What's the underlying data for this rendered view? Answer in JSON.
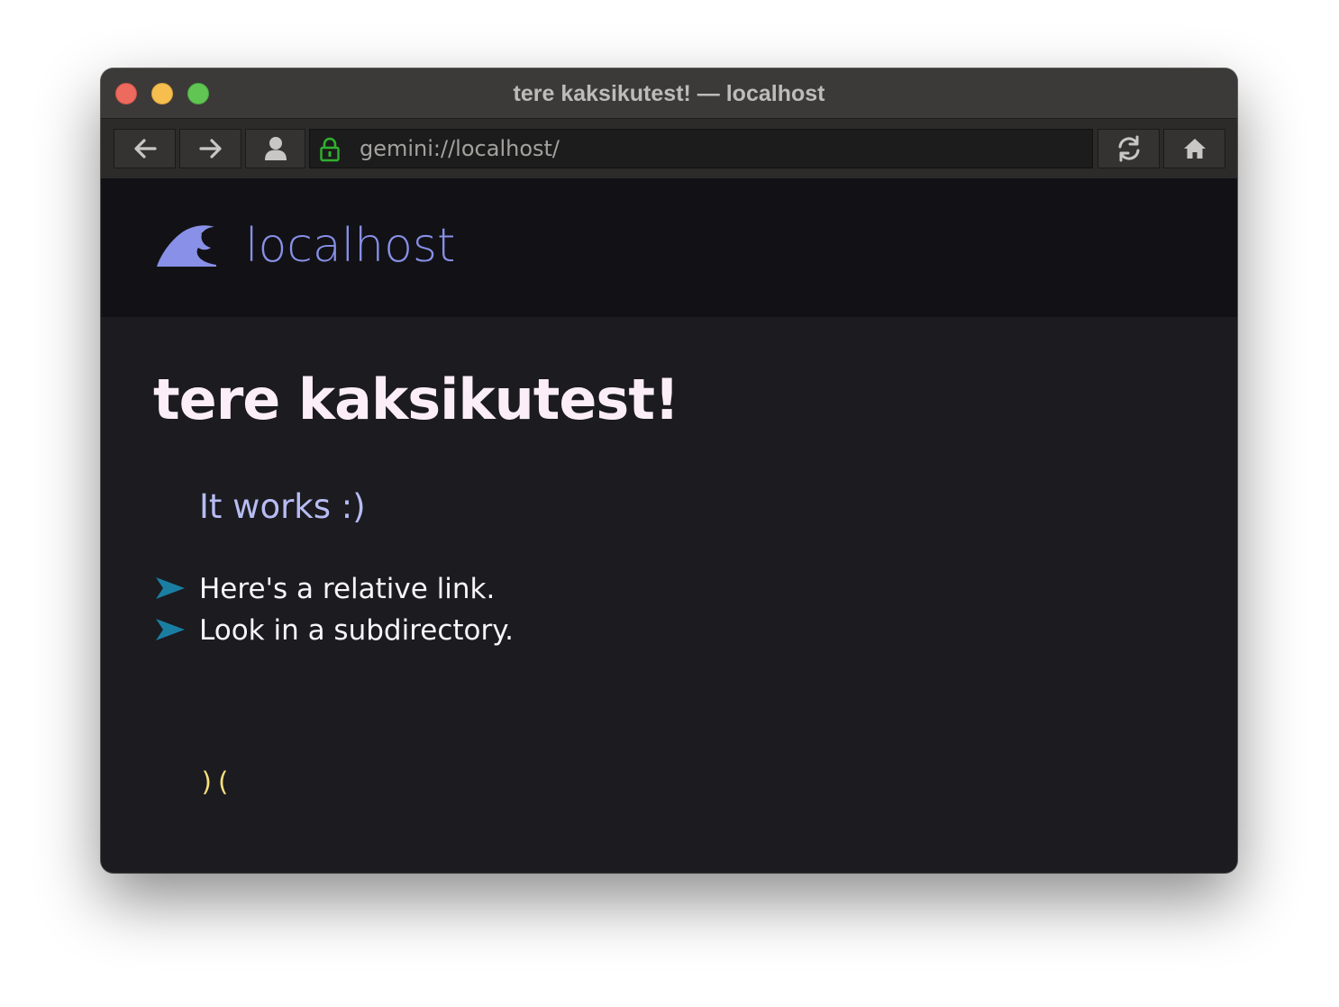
{
  "window": {
    "title": "tere kaksikutest! — localhost"
  },
  "toolbar": {
    "back_icon": "arrow-left-icon",
    "forward_icon": "arrow-right-icon",
    "identity_icon": "person-icon",
    "lock_icon": "lock-icon",
    "url": "gemini://localhost/",
    "reload_icon": "reload-icon",
    "home_icon": "home-icon"
  },
  "banner": {
    "icon": "wave-icon",
    "title": "localhost"
  },
  "page": {
    "heading": "tere kaksikutest!",
    "paragraph": "It works :)",
    "links": [
      {
        "label": "Here's a relative link.",
        "icon": "arrow-bullet-icon"
      },
      {
        "label": "Look in a subdirectory.",
        "icon": "arrow-bullet-icon"
      }
    ],
    "preformatted": ")("
  },
  "colors": {
    "banner_title": "#8890e8",
    "heading": "#fbeef8",
    "paragraph": "#b7bcf2",
    "link_arrow": "#1a7ea3",
    "preformatted": "#f4e07d",
    "lock": "#2fb12f"
  }
}
